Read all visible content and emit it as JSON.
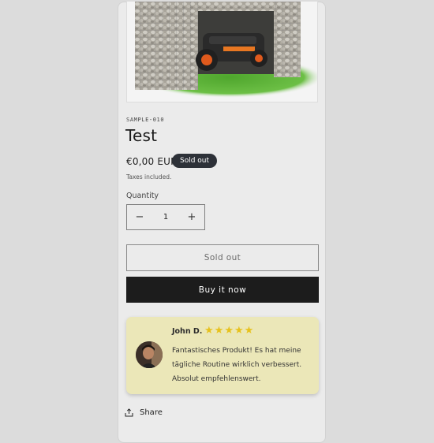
{
  "product": {
    "sku": "SAMPLE-010",
    "title": "Test",
    "price": "€0,00 EUR",
    "badge": "Sold out",
    "taxes": "Taxes included."
  },
  "quantity": {
    "label": "Quantity",
    "value": "1",
    "minus": "−",
    "plus": "+"
  },
  "buttons": {
    "sold_out": "Sold out",
    "buy_now": "Buy it now"
  },
  "review": {
    "author": "John D.",
    "rating": 5,
    "stars": [
      "★",
      "★",
      "★",
      "★",
      "★"
    ],
    "text": "Fantastisches Produkt! Es hat meine tägliche Routine wirklich verbessert. Absolut empfehlenswert."
  },
  "share": {
    "label": "Share"
  },
  "colors": {
    "background": "#dcdcdc",
    "card": "#ebebeb",
    "badge": "#2d3138",
    "buy_button": "#1c1c1c",
    "review_card": "#ebe7b8",
    "star": "#e7c21c"
  },
  "icons": {
    "share": "share-icon"
  }
}
